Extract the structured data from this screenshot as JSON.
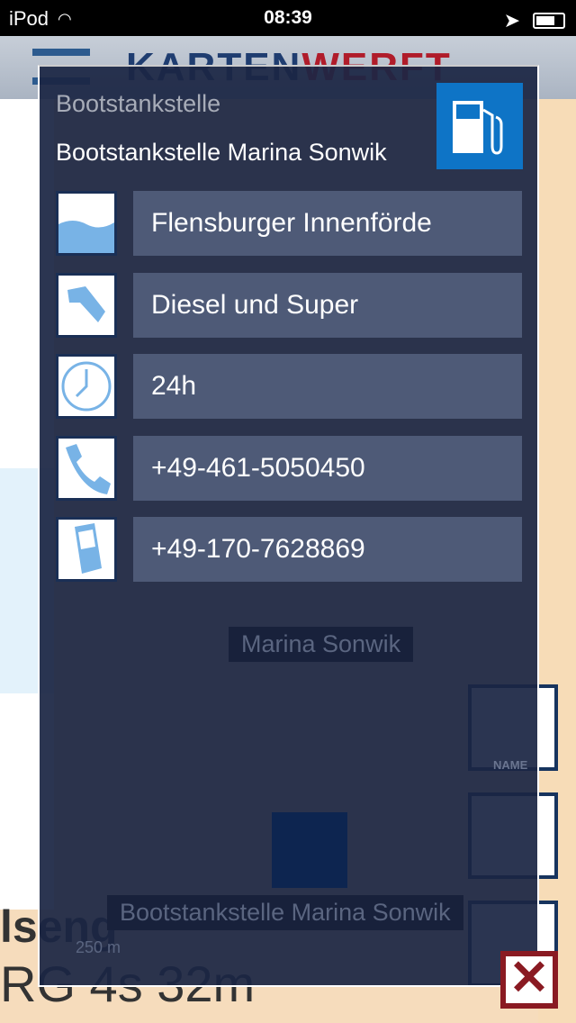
{
  "status": {
    "carrier": "iPod",
    "time": "08:39"
  },
  "app": {
    "logo_left": "KARTEN",
    "logo_right": "WERFT"
  },
  "map": {
    "label_marina": "Marina Sonwik",
    "label_station": "Bootstankstelle Marina Sonwik",
    "scale": "250 m",
    "light": "RG 4s 32m",
    "place": "lseng",
    "name_button": "NAME"
  },
  "popup": {
    "category": "Bootstankstelle",
    "name": "Bootstankstelle Marina Sonwik",
    "rows": [
      {
        "icon": "water-icon",
        "value": "Flensburger Innenförde"
      },
      {
        "icon": "fuel-nozzle-icon",
        "value": "Diesel und Super"
      },
      {
        "icon": "clock-icon",
        "value": "24h"
      },
      {
        "icon": "phone-icon",
        "value": "+49-461-5050450"
      },
      {
        "icon": "mobile-phone-icon",
        "value": "+49-170-7628869"
      }
    ]
  },
  "colors": {
    "accent": "#0e74c6",
    "close": "#8a1a22"
  }
}
